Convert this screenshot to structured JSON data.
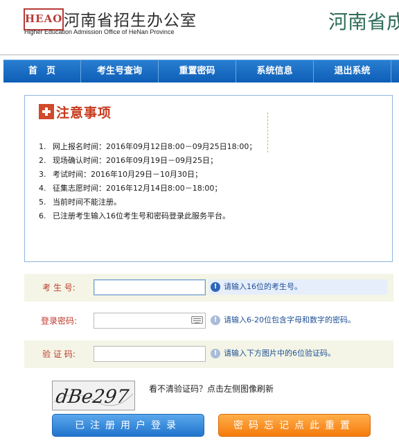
{
  "header": {
    "logo_text": "HEAO",
    "site_name": "河南省招生办公室",
    "site_en": "Higher Education Admission Office of HeNan Province",
    "site_right": "河南省成"
  },
  "nav": {
    "items": [
      {
        "label": "首　页"
      },
      {
        "label": "考生号查询"
      },
      {
        "label": "重置密码"
      },
      {
        "label": "系统信息"
      },
      {
        "label": "退出系统"
      }
    ]
  },
  "notice": {
    "title": "注意事项",
    "items": [
      {
        "num": "1.",
        "text": "网上报名时间：2016年09月12日8:00－09月25日18:00；"
      },
      {
        "num": "2.",
        "text": "现场确认时间：2016年09月19日－09月25日；"
      },
      {
        "num": "3.",
        "text": "考试时间：2016年10月29日－10月30日；"
      },
      {
        "num": "4.",
        "text": "征集志愿时间：2016年12月14日8:00－18:00；"
      },
      {
        "num": "5.",
        "text": "当前时间不能注册。"
      },
      {
        "num": "6.",
        "text": "已注册考生输入16位考生号和密码登录此服务平台。"
      }
    ]
  },
  "form": {
    "exam_no": {
      "label": "考 生 号:",
      "value": "",
      "hint": "请输入16位的考生号。"
    },
    "password": {
      "label": "登录密码:",
      "value": "",
      "hint": "请输入6-20位包含字母和数字的密码。"
    },
    "captcha": {
      "label": "验 证 码:",
      "value": "",
      "hint": "请输入下方图片中的6位验证码。"
    }
  },
  "captcha": {
    "text": "dBe297",
    "tip": "看不清验证码？点击左侧图像刷新"
  },
  "buttons": {
    "login": "已注册用户登录",
    "reset": "密码忘记点此重置"
  },
  "colors": {
    "nav_blue": "#1a6cc4",
    "accent_red": "#c83b1e",
    "hint_blue": "#1d4f94",
    "reset_orange": "#f57b0c"
  }
}
